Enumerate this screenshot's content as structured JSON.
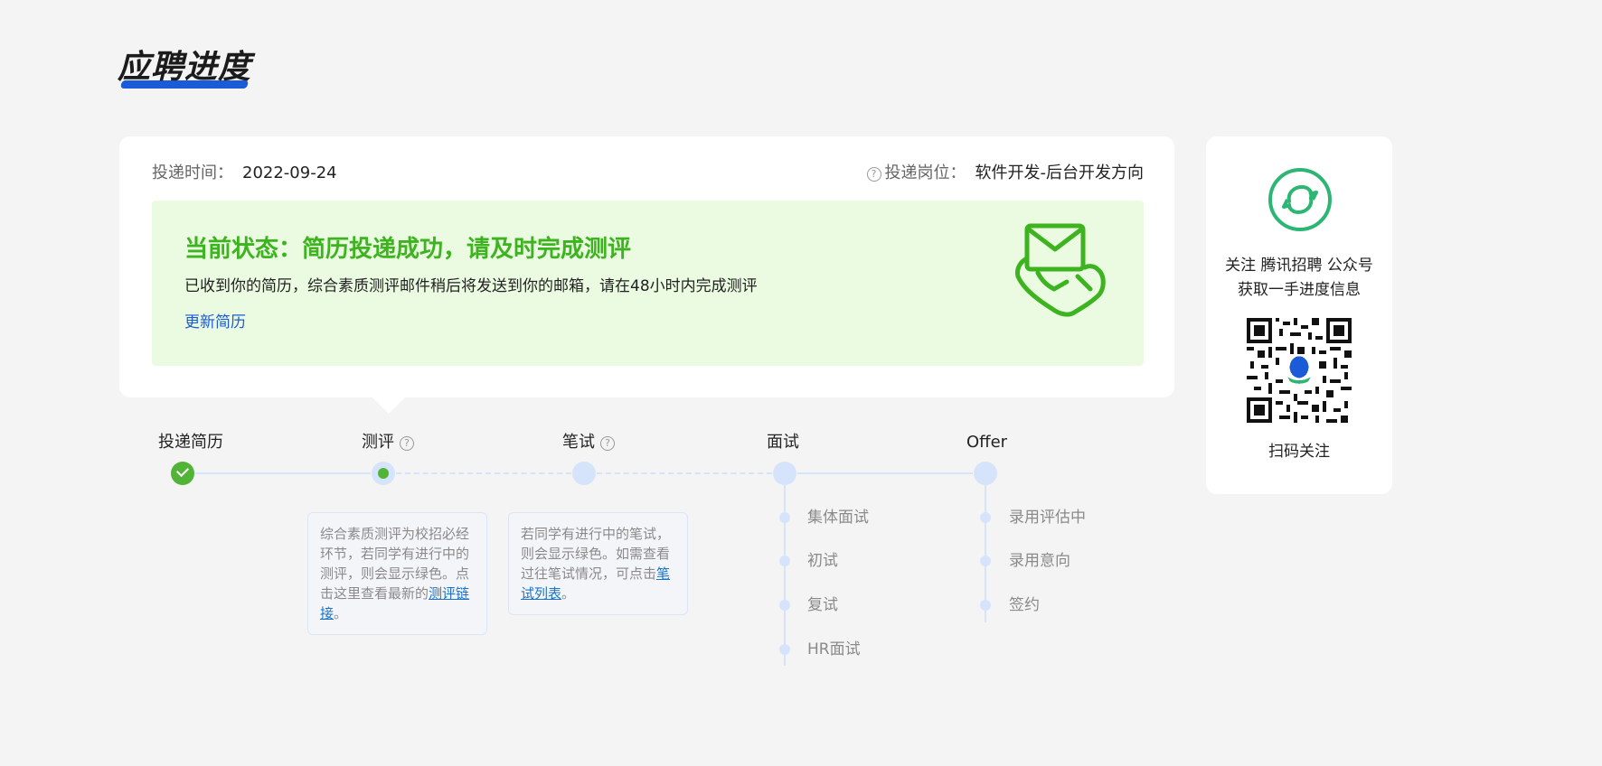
{
  "page": {
    "title": "应聘进度"
  },
  "application": {
    "date_label": "投递时间：",
    "date_value": "2022-09-24",
    "position_label": "投递岗位：",
    "position_value": "软件开发-后台开发方向",
    "help_glyph": "?"
  },
  "status": {
    "title": "当前状态：简历投递成功，请及时完成测评",
    "description": "已收到你的简历，综合素质测评邮件稍后将发送到你的邮箱，请在48小时内完成测评",
    "action_link": "更新简历",
    "accent_color": "#3cb31f",
    "background_color": "#ebfbe1"
  },
  "steps": [
    {
      "label": "投递简历",
      "state": "done"
    },
    {
      "label": "测评",
      "state": "current",
      "has_help": true
    },
    {
      "label": "笔试",
      "state": "pending",
      "has_help": true
    },
    {
      "label": "面试",
      "state": "pending"
    },
    {
      "label": "Offer",
      "state": "pending"
    }
  ],
  "tips": {
    "assessment": {
      "text": "综合素质测评为校招必经环节，若同学有进行中的测评，则会显示绿色。点击这里查看最新的",
      "link": "测评链接",
      "suffix": "。"
    },
    "written_test": {
      "text": "若同学有进行中的笔试，则会显示绿色。如需查看过往笔试情况，可点击",
      "link": "笔试列表",
      "suffix": "。"
    }
  },
  "interview_substeps": [
    "集体面试",
    "初试",
    "复试",
    "HR面试"
  ],
  "offer_substeps": [
    "录用评估中",
    "录用意向",
    "签约"
  ],
  "side": {
    "follow_line1": "关注 腾讯招聘 公众号",
    "follow_line2": "获取一手进度信息",
    "scan_label": "扫码关注",
    "icons": [
      "tencent-recruit-logo-icon",
      "qr-code"
    ]
  },
  "colors": {
    "brand_blue": "#1b5bd8",
    "success_green": "#51b437",
    "track_blue": "#d6e4fb",
    "link_blue": "#1b73c8"
  }
}
